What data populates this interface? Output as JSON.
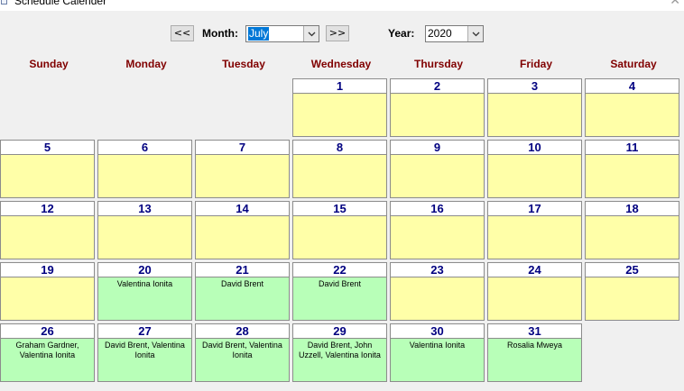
{
  "window": {
    "title": "Schedule Calender"
  },
  "toolbar": {
    "prev_label": "<<",
    "next_label": ">>",
    "month_label": "Month:",
    "month_value": "July",
    "year_label": "Year:",
    "year_value": "2020"
  },
  "weekdays": [
    "Sunday",
    "Monday",
    "Tuesday",
    "Wednesday",
    "Thursday",
    "Friday",
    "Saturday"
  ],
  "calendar": {
    "first_weekday_index": 3,
    "days": [
      {
        "day": "1",
        "names": ""
      },
      {
        "day": "2",
        "names": ""
      },
      {
        "day": "3",
        "names": ""
      },
      {
        "day": "4",
        "names": ""
      },
      {
        "day": "5",
        "names": ""
      },
      {
        "day": "6",
        "names": ""
      },
      {
        "day": "7",
        "names": ""
      },
      {
        "day": "8",
        "names": ""
      },
      {
        "day": "9",
        "names": ""
      },
      {
        "day": "10",
        "names": ""
      },
      {
        "day": "11",
        "names": ""
      },
      {
        "day": "12",
        "names": ""
      },
      {
        "day": "13",
        "names": ""
      },
      {
        "day": "14",
        "names": ""
      },
      {
        "day": "15",
        "names": ""
      },
      {
        "day": "16",
        "names": ""
      },
      {
        "day": "17",
        "names": ""
      },
      {
        "day": "18",
        "names": ""
      },
      {
        "day": "19",
        "names": ""
      },
      {
        "day": "20",
        "names": "Valentina Ionita"
      },
      {
        "day": "21",
        "names": "David Brent"
      },
      {
        "day": "22",
        "names": "David Brent"
      },
      {
        "day": "23",
        "names": ""
      },
      {
        "day": "24",
        "names": ""
      },
      {
        "day": "25",
        "names": ""
      },
      {
        "day": "26",
        "names": "Graham  Gardner, Valentina Ionita"
      },
      {
        "day": "27",
        "names": "David Brent, Valentina Ionita"
      },
      {
        "day": "28",
        "names": "David Brent, Valentina Ionita"
      },
      {
        "day": "29",
        "names": "David Brent, John Uzzell, Valentina Ionita"
      },
      {
        "day": "30",
        "names": "Valentina Ionita"
      },
      {
        "day": "31",
        "names": "Rosalia Mweya"
      }
    ]
  },
  "colors": {
    "empty_day": "#ffffa8",
    "booked_day": "#b8ffb8",
    "day_number": "#000080",
    "weekday_header": "#800000"
  }
}
